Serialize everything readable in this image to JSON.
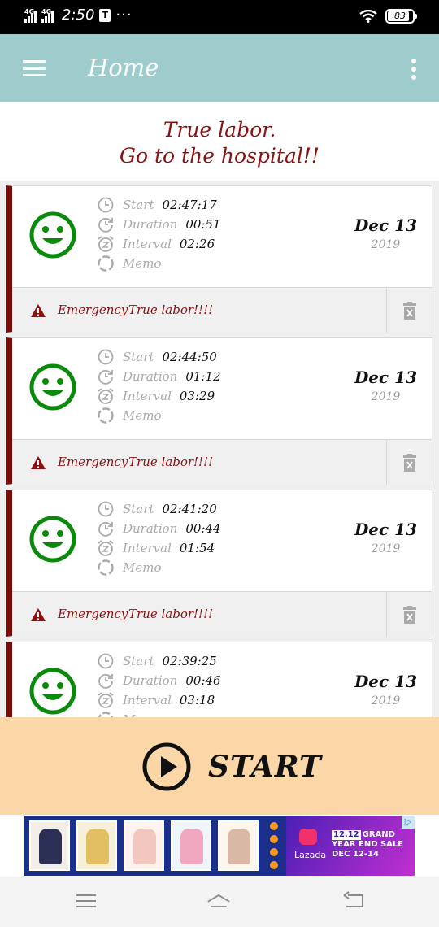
{
  "status_bar": {
    "network_1": "4G",
    "network_2": "4G",
    "time": "2:50",
    "notification_badge": "T",
    "more_dots": "···",
    "battery": "83"
  },
  "app_bar": {
    "title": "Home",
    "menu_icon": "hamburger-menu-icon",
    "more_icon": "more-vert-icon"
  },
  "banner": {
    "line1": "True labor.",
    "line2": "Go to the hospital!!"
  },
  "labels": {
    "start": "Start",
    "duration": "Duration",
    "interval": "Interval",
    "memo": "Memo",
    "emergency": "Emergency"
  },
  "records": [
    {
      "start": "02:47:17",
      "duration": "00:51",
      "interval": "02:26",
      "date": "Dec 13",
      "year": "2019",
      "status": "True labor!!!!"
    },
    {
      "start": "02:44:50",
      "duration": "01:12",
      "interval": "03:29",
      "date": "Dec 13",
      "year": "2019",
      "status": "True labor!!!!"
    },
    {
      "start": "02:41:20",
      "duration": "00:44",
      "interval": "01:54",
      "date": "Dec 13",
      "year": "2019",
      "status": "True labor!!!!"
    },
    {
      "start": "02:39:25",
      "duration": "00:46",
      "interval": "03:18",
      "date": "Dec 13",
      "year": "2019",
      "status": ""
    }
  ],
  "start_button": {
    "label": "START"
  },
  "ad": {
    "brand": "Lazada",
    "promo_badge": "12.12",
    "promo_text": "GRAND YEAR END SALE",
    "promo_dates": "DEC 12-14",
    "info_glyph": "▷"
  },
  "colors": {
    "app_bar": "#9ecbcb",
    "accent_red": "#8b1010",
    "smiley_green": "#0a8a0a",
    "start_area": "#fbd7a8"
  }
}
